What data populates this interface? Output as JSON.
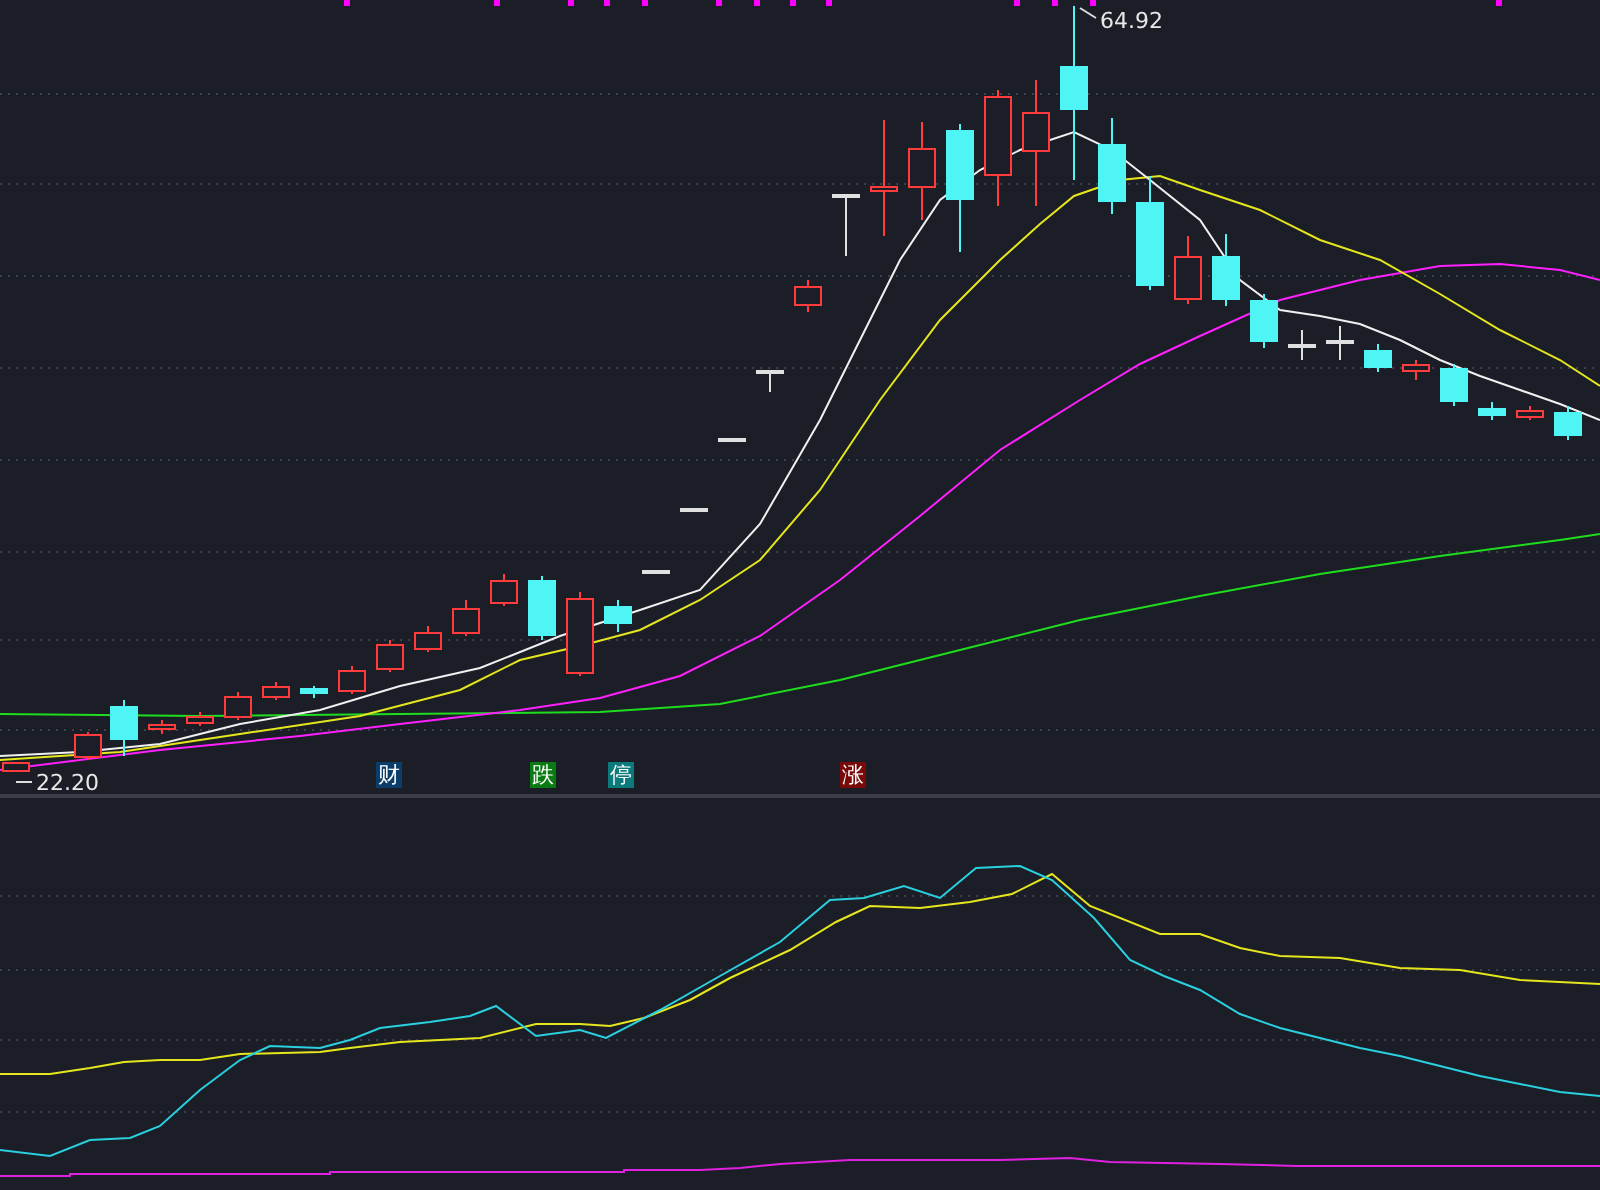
{
  "price_chart": {
    "high_label": "64.92",
    "low_label": "22.20"
  },
  "event_markers": [
    {
      "label": "财",
      "color": "#0b3d6b"
    },
    {
      "label": "跌",
      "color": "#0a7a12"
    },
    {
      "label": "停",
      "color": "#0a7a7a"
    },
    {
      "label": "涨",
      "color": "#7a0a0a"
    }
  ]
}
